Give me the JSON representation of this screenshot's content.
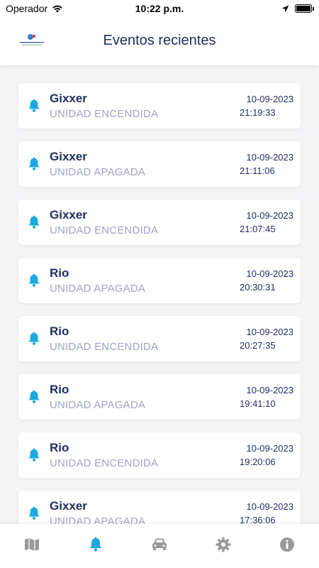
{
  "status_bar": {
    "carrier": "Operador",
    "time": "10:22 p.m."
  },
  "header": {
    "title": "Eventos recientes"
  },
  "events": [
    {
      "unit": "Gixxer",
      "event": "UNIDAD ENCENDIDA",
      "date": "10-09-2023",
      "time": "21:19:33"
    },
    {
      "unit": "Gixxer",
      "event": "UNIDAD APAGADA",
      "date": "10-09-2023",
      "time": "21:11:06"
    },
    {
      "unit": "Gixxer",
      "event": "UNIDAD ENCENDIDA",
      "date": "10-09-2023",
      "time": "21:07:45"
    },
    {
      "unit": "Rio",
      "event": "UNIDAD APAGADA",
      "date": "10-09-2023",
      "time": "20:30:31"
    },
    {
      "unit": "Rio",
      "event": "UNIDAD ENCENDIDA",
      "date": "10-09-2023",
      "time": "20:27:35"
    },
    {
      "unit": "Rio",
      "event": "UNIDAD APAGADA",
      "date": "10-09-2023",
      "time": "19:41:10"
    },
    {
      "unit": "Rio",
      "event": "UNIDAD ENCENDIDA",
      "date": "10-09-2023",
      "time": "19:20:06"
    },
    {
      "unit": "Gixxer",
      "event": "UNIDAD APAGADA",
      "date": "10-09-2023",
      "time": "17:36:06"
    }
  ],
  "bottom_nav": [
    {
      "icon": "map-icon",
      "active": false
    },
    {
      "icon": "bell-icon",
      "active": true
    },
    {
      "icon": "car-icon",
      "active": false
    },
    {
      "icon": "gear-icon",
      "active": false
    },
    {
      "icon": "info-icon",
      "active": false
    }
  ],
  "colors": {
    "accent": "#1aa8e0",
    "title": "#1f2d5c",
    "muted": "#a0a3c0",
    "inactive_icon": "#9a9a9a"
  }
}
